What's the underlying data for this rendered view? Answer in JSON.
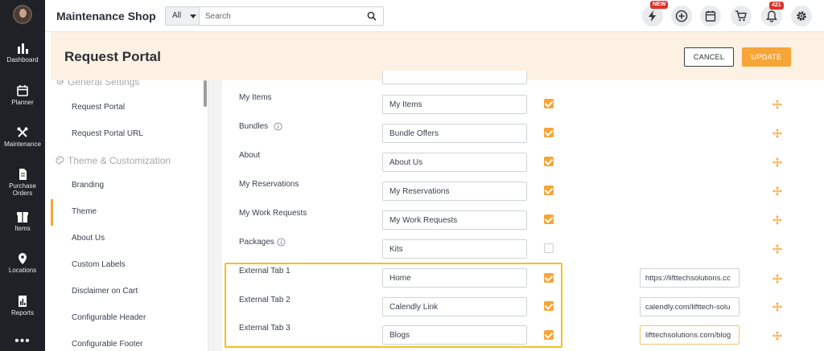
{
  "app": {
    "title": "Maintenance Shop"
  },
  "sidebar": {
    "items": [
      {
        "label": "Dashboard",
        "icon": "dashboard-icon"
      },
      {
        "label": "Planner",
        "icon": "calendar-icon"
      },
      {
        "label": "Maintenance",
        "icon": "tools-icon"
      },
      {
        "label": "Purchase Orders",
        "icon": "document-icon"
      },
      {
        "label": "Items",
        "icon": "box-icon"
      },
      {
        "label": "Locations",
        "icon": "map-pin-icon"
      },
      {
        "label": "Reports",
        "icon": "report-icon"
      },
      {
        "label": "•••",
        "icon": "more-icon"
      }
    ]
  },
  "search": {
    "scope": "All",
    "placeholder": "Search"
  },
  "header_icons": {
    "new_badge": "NEW",
    "notification_count": "421"
  },
  "page": {
    "title": "Request Portal",
    "cancel_label": "CANCEL",
    "update_label": "UPDATE"
  },
  "settings_nav": {
    "general_section": "General Settings",
    "general_items": [
      "Request Portal",
      "Request Portal URL"
    ],
    "theme_section": "Theme & Customization",
    "theme_items": [
      "Branding",
      "Theme",
      "About Us",
      "Custom Labels",
      "Disclaimer on Cart",
      "Configurable Header",
      "Configurable Footer"
    ],
    "active_item": "Theme"
  },
  "tabs": [
    {
      "label": "My Items",
      "value": "My Items",
      "checked": true,
      "info": false,
      "url": ""
    },
    {
      "label": "Bundles",
      "value": "Bundle Offers",
      "checked": true,
      "info": true,
      "url": ""
    },
    {
      "label": "About",
      "value": "About Us",
      "checked": true,
      "info": false,
      "url": ""
    },
    {
      "label": "My Reservations",
      "value": "My Reservations",
      "checked": true,
      "info": false,
      "url": ""
    },
    {
      "label": "My Work Requests",
      "value": "My Work Requests",
      "checked": true,
      "info": false,
      "url": ""
    },
    {
      "label": "Packages",
      "value": "Kits",
      "checked": false,
      "info": true,
      "url": ""
    },
    {
      "label": "External Tab 1",
      "value": "Home",
      "checked": true,
      "info": false,
      "url": "https://lifttechsolutions.cc"
    },
    {
      "label": "External Tab 2",
      "value": "Calendly Link",
      "checked": true,
      "info": false,
      "url": "calendly.com/lifttech-solu"
    },
    {
      "label": "External Tab 3",
      "value": "Blogs",
      "checked": true,
      "info": false,
      "url": "lifttechsolutions.com/blog"
    }
  ],
  "colors": {
    "accent": "#f6a537",
    "sidebar_bg": "#1f2127",
    "header_band": "#fdf1e3",
    "highlight": "#f4c020"
  }
}
